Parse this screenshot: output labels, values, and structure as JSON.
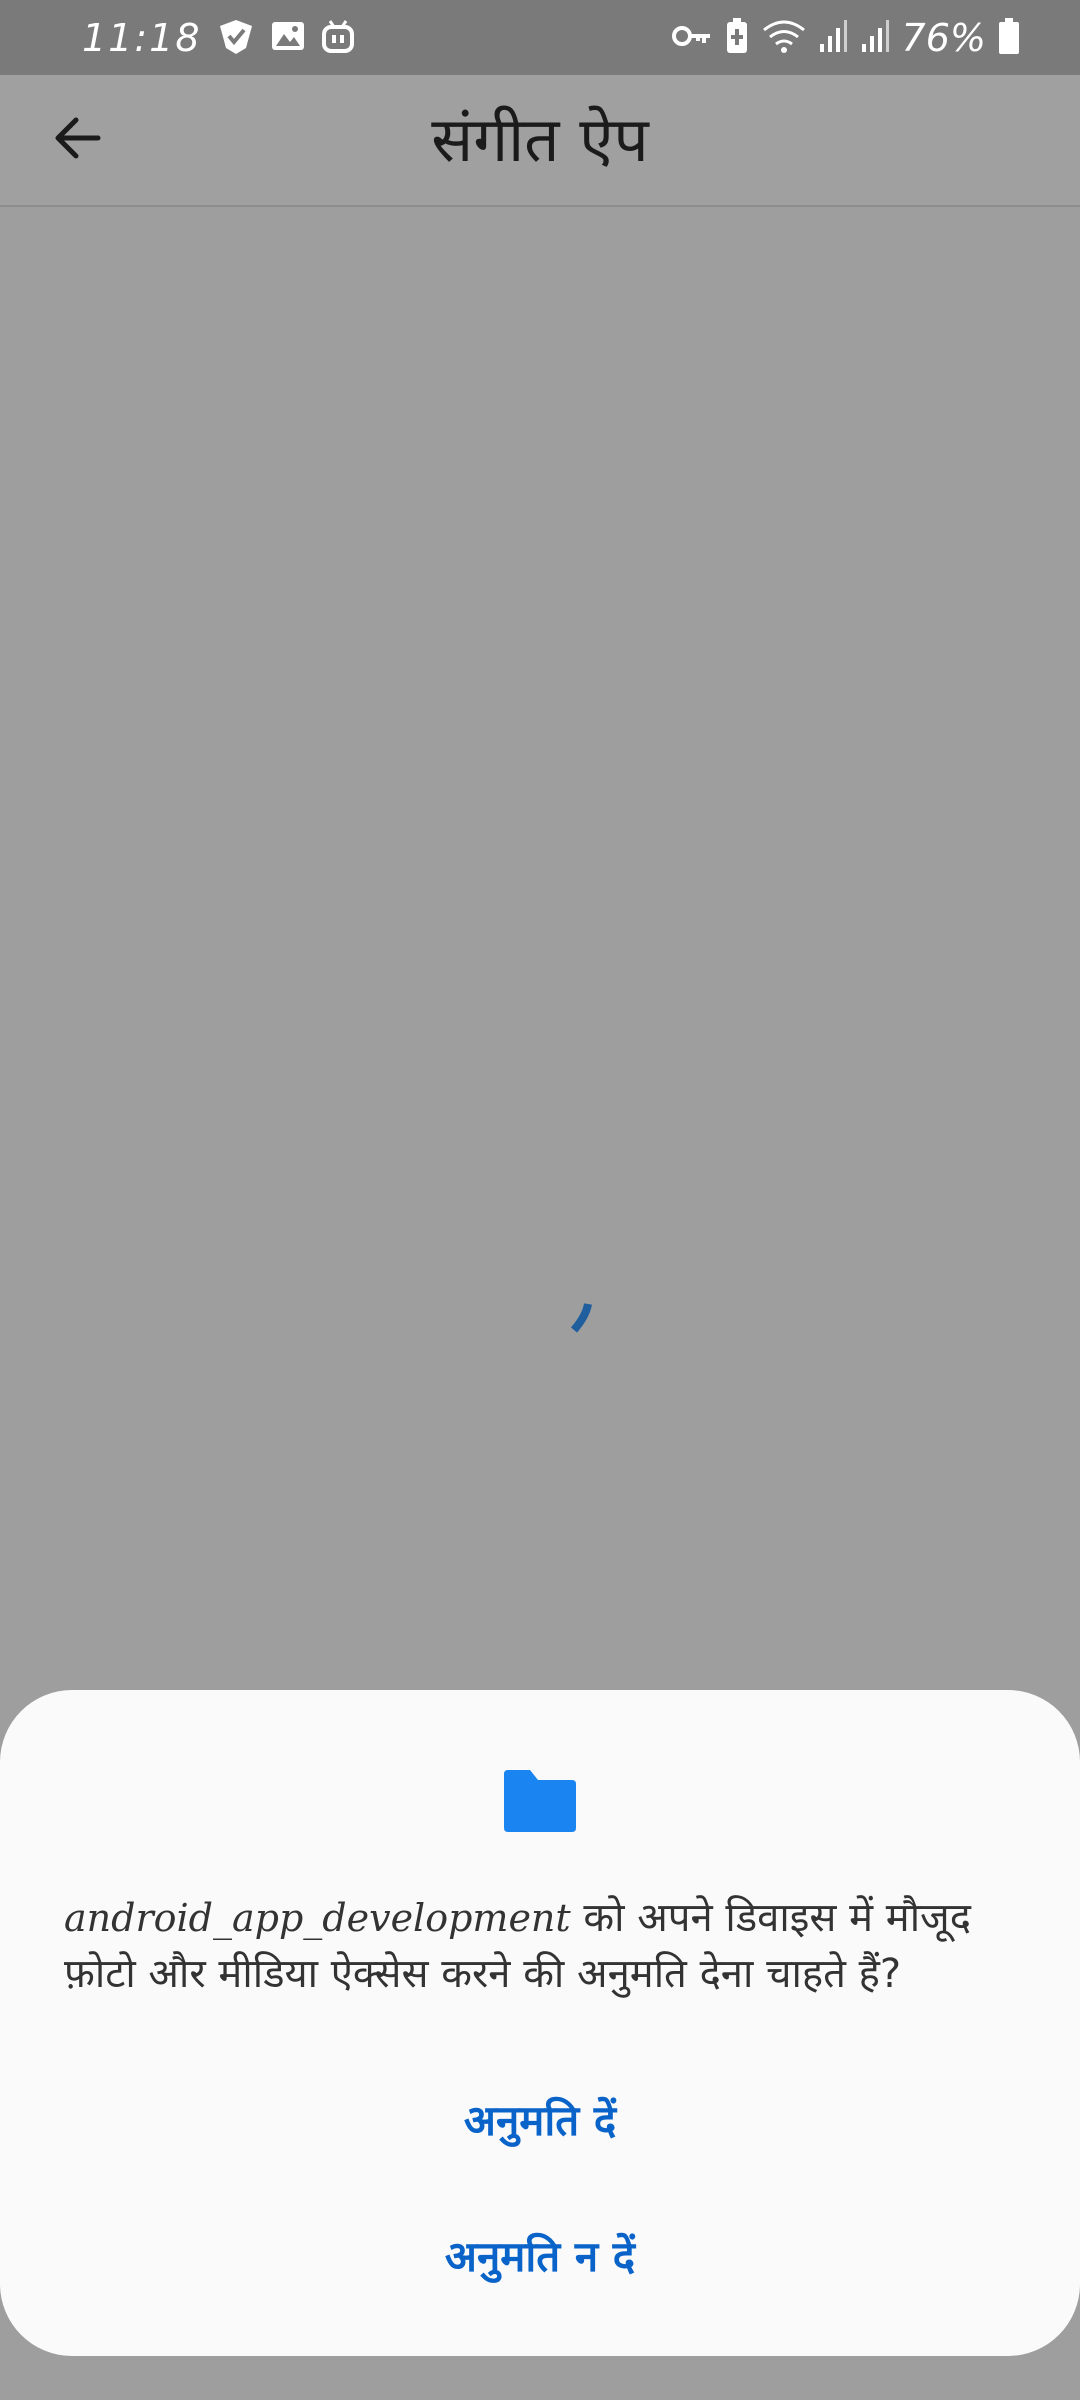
{
  "status_bar": {
    "time": "11:18",
    "battery": "76%",
    "left_icons": [
      "vpn-check-icon",
      "gallery-icon",
      "robot-icon"
    ],
    "right_icons": [
      "key-icon",
      "battery-saver-icon",
      "wifi-icon",
      "signal-icon",
      "signal-icon",
      "battery-icon"
    ]
  },
  "app_bar": {
    "title": "संगीत ऐप",
    "back_icon": "arrow-left-icon"
  },
  "dialog": {
    "icon": "folder-icon",
    "app_name": "android_app_development",
    "message": " को अपने डिवाइस में मौजूद फ़ोटो और मीडिया ऐक्सेस करने की अनुमति देना चाहते हैं?",
    "allow_label": "अनुमति दें",
    "deny_label": "अनुमति न दें"
  },
  "colors": {
    "accent": "#0a63c9",
    "folder": "#1a84f0",
    "spinner": "#1f5f9e",
    "scrim": "#9e9e9e",
    "sheet": "#fafafa"
  }
}
